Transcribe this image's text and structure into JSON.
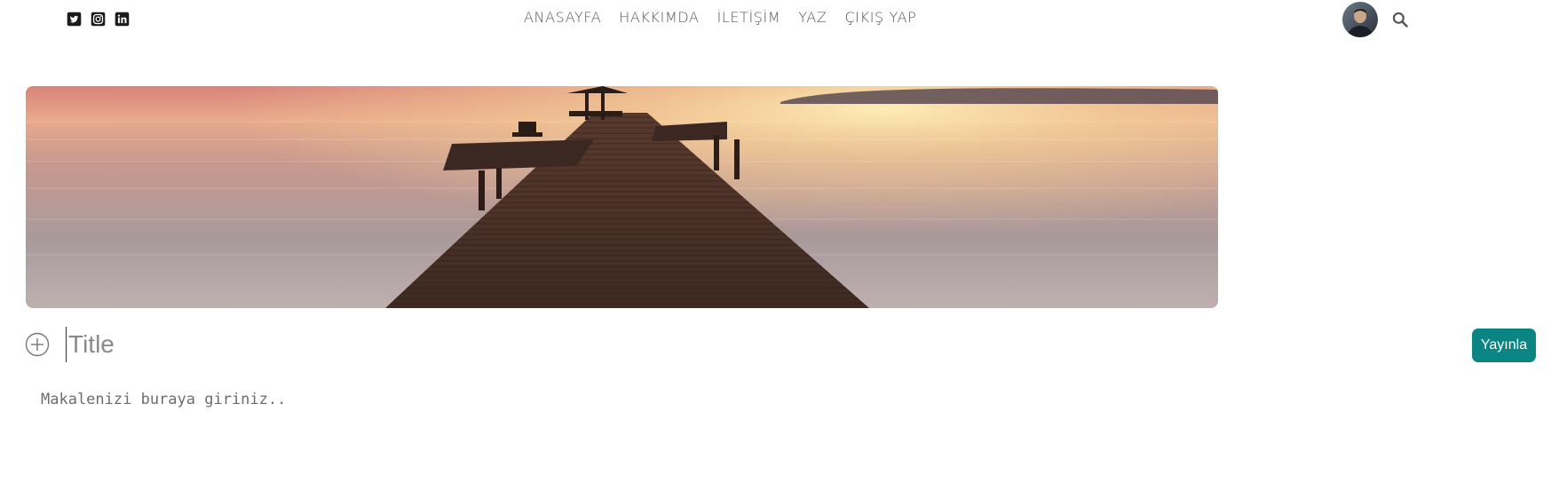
{
  "social": {
    "items": [
      {
        "name": "twitter",
        "icon": "twitter-icon"
      },
      {
        "name": "instagram",
        "icon": "instagram-icon"
      },
      {
        "name": "linkedin",
        "icon": "linkedin-icon"
      }
    ]
  },
  "nav": {
    "items": [
      {
        "label": "ANASAYFA"
      },
      {
        "label": "HAKKIMDA"
      },
      {
        "label": "İLETİŞİM"
      },
      {
        "label": "YAZ"
      },
      {
        "label": "ÇIKIŞ YAP"
      }
    ]
  },
  "header": {
    "avatar_icon": "user-avatar",
    "search_icon": "search-icon"
  },
  "hero": {
    "image": "sunset-pier-photo"
  },
  "editor": {
    "title_placeholder": "Title",
    "body_placeholder": "Makalenizi buraya giriniz..",
    "publish_label": "Yayınla",
    "add_icon": "plus-circle-icon"
  },
  "colors": {
    "accent": "#0b8583",
    "nav_text": "#555555"
  }
}
